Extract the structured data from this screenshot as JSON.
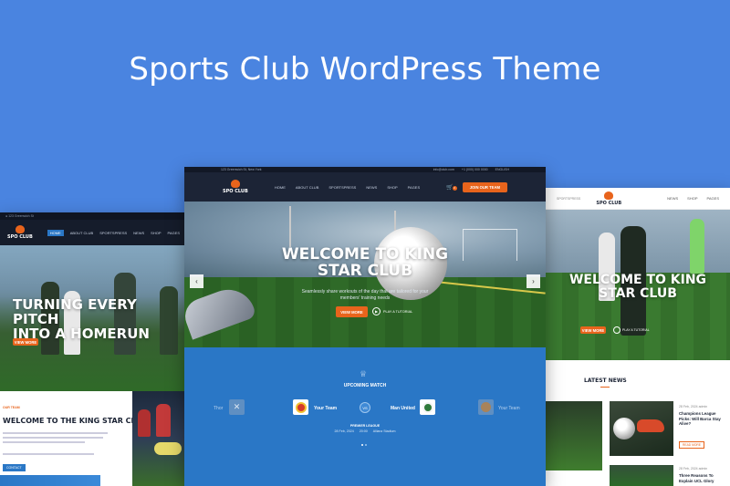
{
  "headline": "Sports Club WordPress Theme",
  "colors": {
    "background": "#4a84e0",
    "accent": "#e8641c",
    "dark": "#1a2233",
    "match_bg": "#2a77c6"
  },
  "center": {
    "topbar": {
      "address": "123 Greenwich St, New York",
      "email": "info@club.com",
      "phone": "+1 (000) 000 0000",
      "language": "ENGLISH"
    },
    "logo": "SPO CLUB",
    "nav": [
      "HOME",
      "ABOUT CLUB",
      "SPORTSPRESS",
      "NEWS",
      "SHOP",
      "PAGES"
    ],
    "cart_count": "0",
    "join_button": "JOIN OUR TEAM",
    "hero": {
      "title_line1": "WELCOME TO KING",
      "title_line2": "STAR CLUB",
      "subtitle_line1": "Seamlessly share workouts of the day that are tailored for your",
      "subtitle_line2": "members' training needs",
      "primary_button": "VIEW MORE",
      "secondary_button": "PLAY A TUTORIAL"
    },
    "match": {
      "heading": "UPCOMING MATCH",
      "league": "PREMIER LEAGUE",
      "date": "28 Feb, 2024",
      "time": "20:00",
      "venue": "Allianz Stadium",
      "left_partial_team": "Thor",
      "home_team": "Your Team",
      "vs": "VS",
      "away_team": "Man United",
      "right_partial_team": "Your Team"
    }
  },
  "left": {
    "logo": "SPO CLUB",
    "nav": [
      "HOME",
      "ABOUT CLUB",
      "SPORTSPRESS",
      "NEWS",
      "SHOP",
      "PAGES"
    ],
    "hero_title_line1": "TURNING EVERY PITCH",
    "hero_title_line2": "INTO A HOMERUN",
    "button": "VIEW MORE",
    "section_tag": "OUR TEAM",
    "section_title": "WELCOME TO THE KING STAR CLUB",
    "button2": "CONTACT"
  },
  "right": {
    "logo": "SPO CLUB",
    "nav": [
      "NEWS",
      "SHOP",
      "PAGES"
    ],
    "hero_title_line1": "WELCOME TO KING",
    "hero_title_line2": "STAR CLUB",
    "button": "VIEW MORE",
    "secondary": "PLAY A TUTORIAL",
    "news_heading": "LATEST NEWS",
    "news": [
      {
        "meta": "28 Feb, 2024  admin",
        "title": "Champions League Picks: Will Barca Stay Alive?",
        "more": "READ MORE"
      },
      {
        "meta": "28 Feb, 2024  admin",
        "title": "Three Reasons To Explain UCL Glory",
        "more": ""
      }
    ]
  }
}
